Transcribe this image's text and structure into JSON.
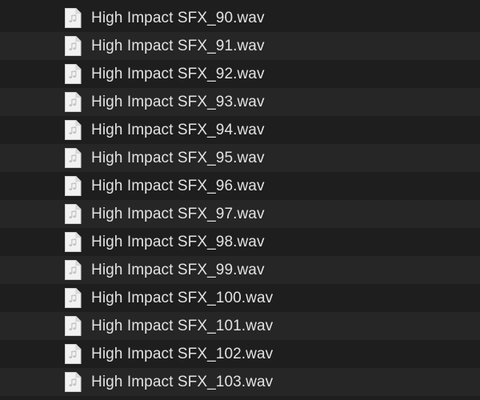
{
  "file_browser": {
    "files": [
      {
        "name": "High Impact SFX_90.wav",
        "icon": "audio-file-icon"
      },
      {
        "name": "High Impact SFX_91.wav",
        "icon": "audio-file-icon"
      },
      {
        "name": "High Impact SFX_92.wav",
        "icon": "audio-file-icon"
      },
      {
        "name": "High Impact SFX_93.wav",
        "icon": "audio-file-icon"
      },
      {
        "name": "High Impact SFX_94.wav",
        "icon": "audio-file-icon"
      },
      {
        "name": "High Impact SFX_95.wav",
        "icon": "audio-file-icon"
      },
      {
        "name": "High Impact SFX_96.wav",
        "icon": "audio-file-icon"
      },
      {
        "name": "High Impact SFX_97.wav",
        "icon": "audio-file-icon"
      },
      {
        "name": "High Impact SFX_98.wav",
        "icon": "audio-file-icon"
      },
      {
        "name": "High Impact SFX_99.wav",
        "icon": "audio-file-icon"
      },
      {
        "name": "High Impact SFX_100.wav",
        "icon": "audio-file-icon"
      },
      {
        "name": "High Impact SFX_101.wav",
        "icon": "audio-file-icon"
      },
      {
        "name": "High Impact SFX_102.wav",
        "icon": "audio-file-icon"
      },
      {
        "name": "High Impact SFX_103.wav",
        "icon": "audio-file-icon"
      }
    ],
    "colors": {
      "background": "#1e1e1e",
      "row_alt": "#262627",
      "text": "#e3e3e3",
      "icon_page": "#f2f2f2"
    }
  }
}
